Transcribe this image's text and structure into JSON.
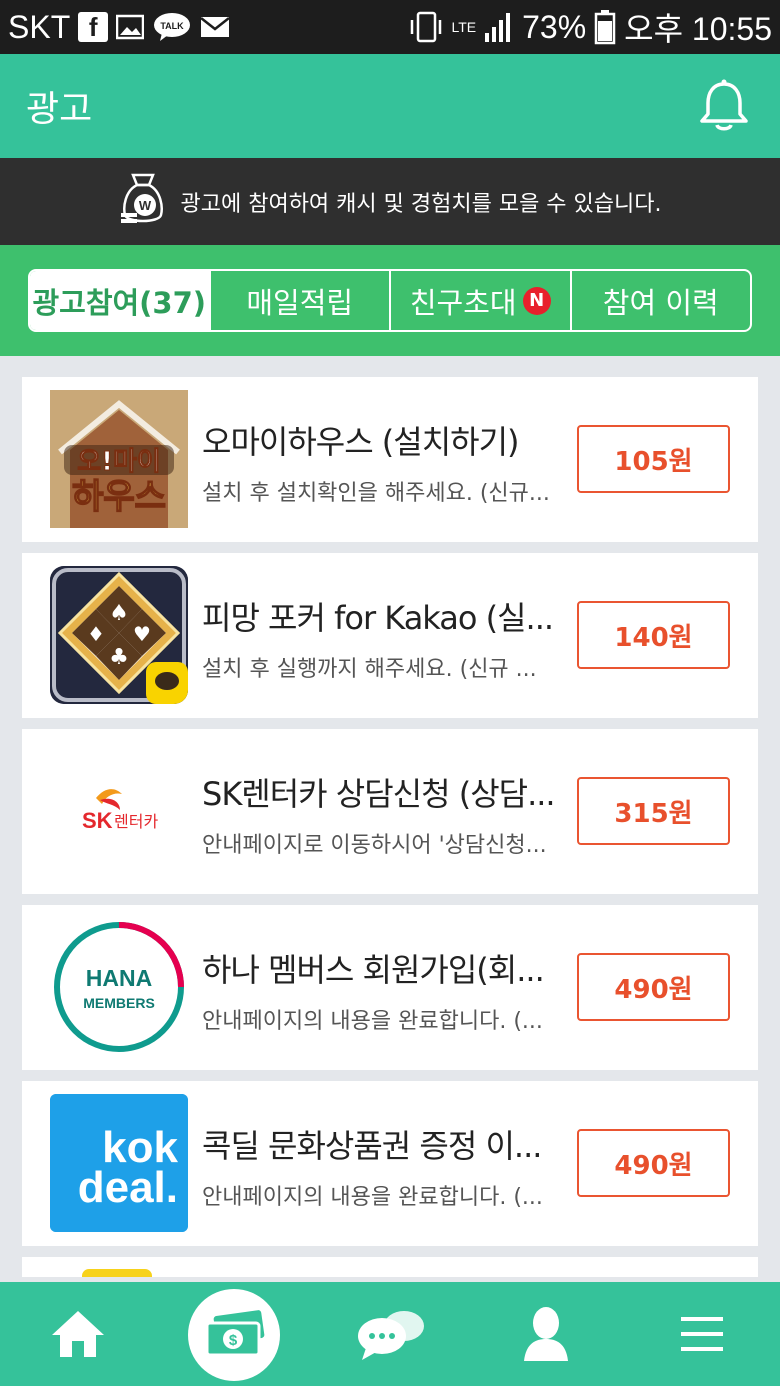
{
  "status_bar": {
    "carrier": "SKT",
    "notification_icons": [
      "facebook-icon",
      "gallery-icon",
      "kakaotalk-icon",
      "mail-icon"
    ],
    "talk_label": "TALK",
    "network": "LTE",
    "battery": "73%",
    "time": "오후 10:55"
  },
  "header": {
    "title": "광고"
  },
  "banner": {
    "text": "광고에 참여하여 캐시 및 경험치를 모을 수 있습니다."
  },
  "tabs": [
    {
      "label": "광고참여(37)",
      "active": true
    },
    {
      "label": "매일적립",
      "active": false
    },
    {
      "label": "친구초대",
      "active": false,
      "badge": "N"
    },
    {
      "label": "참여 이력",
      "active": false
    }
  ],
  "ads": [
    {
      "title": "오마이하우스 (설치하기)",
      "desc": "설치 후 설치확인을 해주세요. (신규...",
      "price": "105원",
      "thumb_text": [
        "오!마이",
        "하우스"
      ]
    },
    {
      "title": "피망 포커 for Kakao (실...",
      "desc": "설치 후 실행까지 해주세요. (신규 ...",
      "price": "140원"
    },
    {
      "title": "SK렌터카 상담신청 (상담...",
      "desc": "안내페이지로 이동하시어 '상담신청...",
      "price": "315원",
      "thumb_text": [
        "SK",
        "렌터카"
      ]
    },
    {
      "title": "하나 멤버스 회원가입(회...",
      "desc": "안내페이지의 내용을 완료합니다. (...",
      "price": "490원",
      "thumb_text": [
        "HANA",
        "MEMBERS"
      ]
    },
    {
      "title": "콕딜 문화상품권 증정 이...",
      "desc": "안내페이지의 내용을 완료합니다. (...",
      "price": "490원",
      "thumb_text": [
        "kok",
        "deal."
      ]
    }
  ],
  "bottom_nav": [
    "home-icon",
    "cash-icon",
    "chat-icon",
    "profile-icon",
    "menu-icon"
  ],
  "colors": {
    "header": "#35c29a",
    "tabbar": "#3ec06d",
    "banner": "#2f2f2f",
    "price": "#e8502c"
  }
}
